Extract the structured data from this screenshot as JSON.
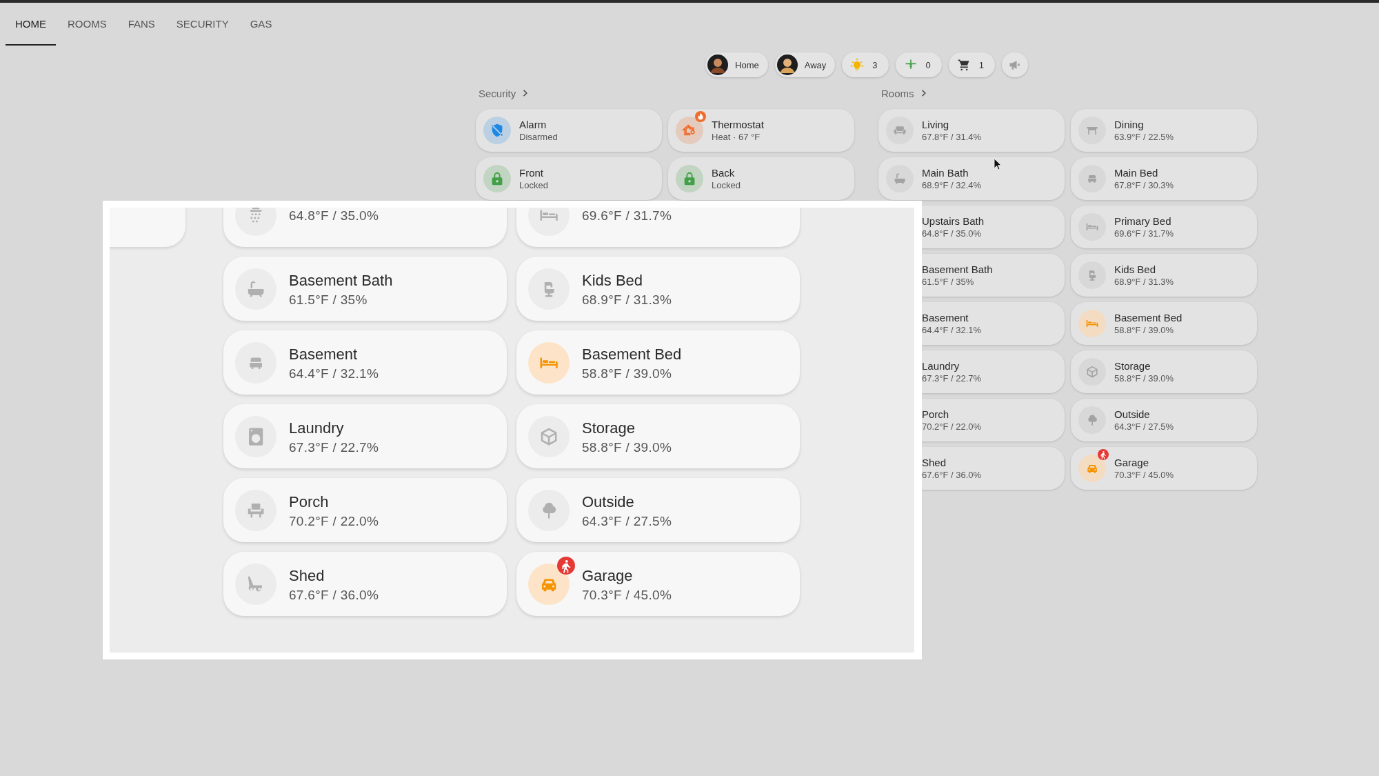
{
  "tabs": [
    {
      "label": "HOME",
      "selected": true
    },
    {
      "label": "ROOMS",
      "selected": false
    },
    {
      "label": "FANS",
      "selected": false
    },
    {
      "label": "SECURITY",
      "selected": false
    },
    {
      "label": "GAS",
      "selected": false
    }
  ],
  "chips": [
    {
      "kind": "person",
      "label": "Home"
    },
    {
      "kind": "person",
      "label": "Away"
    },
    {
      "kind": "lights",
      "label": "3"
    },
    {
      "kind": "fans",
      "label": "0"
    },
    {
      "kind": "cart",
      "label": "1"
    },
    {
      "kind": "announce"
    }
  ],
  "security": {
    "title": "Security",
    "cards": [
      {
        "kind": "alarm",
        "name": "Alarm",
        "state": "Disarmed",
        "color": "#1e88e5",
        "badge": false
      },
      {
        "kind": "climate",
        "name": "Thermostat",
        "state": "Heat · 67 °F",
        "color": "#ef6c2a",
        "badge": true
      },
      {
        "kind": "lock",
        "name": "Front",
        "state": "Locked",
        "color": "#43a047",
        "badge": false
      },
      {
        "kind": "lock",
        "name": "Back",
        "state": "Locked",
        "color": "#43a047",
        "badge": false
      }
    ]
  },
  "rooms": {
    "title": "Rooms",
    "cards": [
      {
        "name": "Living",
        "reading": "67.8°F / 31.4%",
        "active": false,
        "badge": false
      },
      {
        "name": "Dining",
        "reading": "63.9°F / 22.5%",
        "active": false,
        "badge": false
      },
      {
        "name": "Main Bath",
        "reading": "68.9°F / 32.4%",
        "active": false,
        "badge": false
      },
      {
        "name": "Main Bed",
        "reading": "67.8°F / 30.3%",
        "active": false,
        "badge": false
      },
      {
        "name": "Upstairs Bath",
        "reading": "64.8°F / 35.0%"
      },
      {
        "name": "Primary Bed",
        "reading": "69.6°F / 31.7%",
        "active": false,
        "badge": false
      },
      {
        "name": "Basement Bath",
        "reading": "61.5°F / 35%"
      },
      {
        "name": "Kids Bed",
        "reading": "68.9°F / 31.3%",
        "active": false,
        "badge": false
      },
      {
        "name": "Basement",
        "reading": "64.4°F / 32.1%"
      },
      {
        "name": "Basement Bed",
        "reading": "58.8°F / 39.0%",
        "active": true,
        "badge": false
      },
      {
        "name": "Laundry",
        "reading": "67.3°F / 22.7%"
      },
      {
        "name": "Storage",
        "reading": "58.8°F / 39.0%",
        "active": false,
        "badge": false
      },
      {
        "name": "Porch",
        "reading": "70.2°F / 22.0%"
      },
      {
        "name": "Outside",
        "reading": "64.3°F / 27.5%",
        "active": false,
        "badge": false
      },
      {
        "name": "Shed",
        "reading": "67.6°F / 36.0%"
      },
      {
        "name": "Garage",
        "reading": "70.3°F / 45.0%",
        "active": true,
        "badge": true
      }
    ]
  },
  "magnifier": {
    "cards": [
      {
        "reading": "64.8°F / 35.0%",
        "active": false,
        "badge": false
      },
      {
        "reading": "69.6°F / 31.7%",
        "active": false,
        "badge": false
      },
      {
        "name": "Basement Bath",
        "reading": "61.5°F / 35%",
        "active": false,
        "badge": false
      },
      {
        "name": "Kids Bed",
        "reading": "68.9°F / 31.3%",
        "active": false,
        "badge": false
      },
      {
        "name": "Basement",
        "reading": "64.4°F / 32.1%",
        "active": false,
        "badge": false
      },
      {
        "name": "Basement Bed",
        "reading": "58.8°F / 39.0%",
        "active": true,
        "badge": false
      },
      {
        "name": "Laundry",
        "reading": "67.3°F / 22.7%",
        "active": false,
        "badge": false
      },
      {
        "name": "Storage",
        "reading": "58.8°F / 39.0%",
        "active": false,
        "badge": false
      },
      {
        "name": "Porch",
        "reading": "70.2°F / 22.0%",
        "active": false,
        "badge": false
      },
      {
        "name": "Outside",
        "reading": "64.3°F / 27.5%",
        "active": false,
        "badge": false
      },
      {
        "name": "Shed",
        "reading": "67.6°F / 36.0%",
        "active": false,
        "badge": false
      },
      {
        "name": "Garage",
        "reading": "70.3°F / 45.0%",
        "active": true,
        "badge": true
      }
    ]
  }
}
